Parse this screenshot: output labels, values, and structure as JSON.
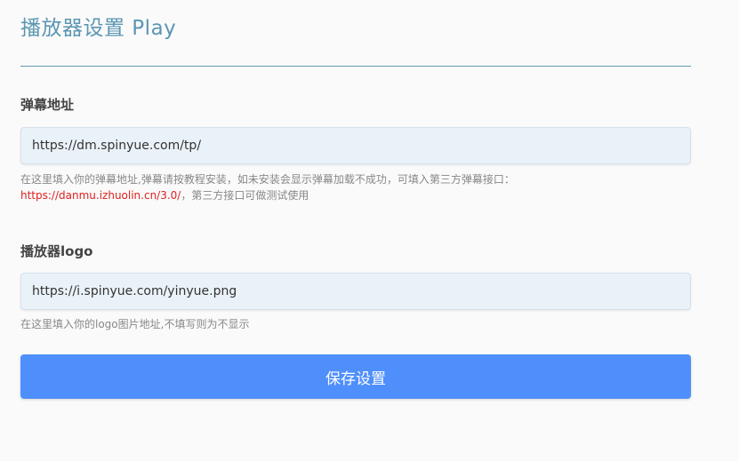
{
  "page": {
    "title": "播放器设置 Play"
  },
  "danmu": {
    "label": "弹幕地址",
    "value": "https://dm.spinyue.com/tp/",
    "help_text": "在这里填入你的弹幕地址,弹幕请按教程安装，如未安装会显示弹幕加载不成功，可填入第三方弹幕接口：",
    "help_link": "https://danmu.izhuolin.cn/3.0/",
    "help_suffix": "，第三方接口可做测试使用"
  },
  "logo": {
    "label": "播放器logo",
    "value": "https://i.spinyue.com/yinyue.png",
    "help_text": "在这里填入你的logo图片地址,不填写则为不显示"
  },
  "actions": {
    "save_label": "保存设置"
  },
  "colors": {
    "title": "#5b96b3",
    "primary_button": "#4f8ffb",
    "link_red": "#e02020"
  }
}
